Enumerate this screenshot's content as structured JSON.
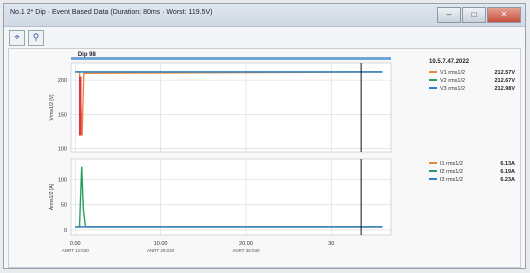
{
  "window": {
    "title": "No.1 2* Dip · Event Based Data (Duration: 80ms · Worst: 119.5V)",
    "minimize_icon": "minimize-icon",
    "maximize_icon": "maximize-icon",
    "close_icon": "close-icon"
  },
  "toolbar": {
    "icons": [
      "cursor-icon",
      "zoom-icon"
    ]
  },
  "marker_label": "Dip 98",
  "legend": {
    "timestamp": "10.5.7.47.2022",
    "voltage": [
      {
        "label": "V1 rms1/2",
        "value": "212.57V",
        "color": "#e8893a"
      },
      {
        "label": "V2 rms1/2",
        "value": "212.67V",
        "color": "#2a9e62"
      },
      {
        "label": "V3 rms1/2",
        "value": "212.98V",
        "color": "#2f7fd1"
      }
    ],
    "current": [
      {
        "label": "I1 rms1/2",
        "value": "6.13A",
        "color": "#e8893a"
      },
      {
        "label": "I2 rms1/2",
        "value": "6.19A",
        "color": "#2a9e62"
      },
      {
        "label": "I3 rms1/2",
        "value": "6.23A",
        "color": "#2f7fd1"
      }
    ]
  },
  "chart_data": [
    {
      "type": "line",
      "ylabel": "Vrms1/2 [V]",
      "yticks": [
        "200",
        "150",
        "100"
      ],
      "series": [
        {
          "name": "V1 rms1/2",
          "color": "#e8893a",
          "x": [
            0,
            0.5,
            0.8,
            1.0,
            36.0
          ],
          "y": [
            212,
            212,
            119,
            210,
            212
          ]
        },
        {
          "name": "V2 rms1/2",
          "color": "#2a9e62",
          "x": [
            0,
            36.0
          ],
          "y": [
            212,
            212
          ]
        },
        {
          "name": "V3 rms1/2",
          "color": "#2f7fd1",
          "x": [
            0,
            36.0
          ],
          "y": [
            212,
            212
          ]
        }
      ],
      "ylim": [
        95,
        225
      ]
    },
    {
      "type": "line",
      "ylabel": "Arms1/2 [A]",
      "yticks": [
        "100",
        "50",
        "0"
      ],
      "series": [
        {
          "name": "I1 rms1/2",
          "color": "#e8893a",
          "x": [
            0,
            0.6,
            1.0,
            36.0
          ],
          "y": [
            6,
            6,
            6,
            6
          ]
        },
        {
          "name": "I2 rms1/2",
          "color": "#2a9e62",
          "x": [
            0,
            0.5,
            0.75,
            0.95,
            1.2,
            36.0
          ],
          "y": [
            6,
            6,
            125,
            40,
            6,
            6
          ]
        },
        {
          "name": "I3 rms1/2",
          "color": "#2f7fd1",
          "x": [
            0,
            36.0
          ],
          "y": [
            6,
            6
          ]
        }
      ],
      "ylim": [
        -10,
        140
      ]
    }
  ],
  "x_axis": {
    "ticks": [
      {
        "main": "0.00",
        "sub": "ANRT 12:030"
      },
      {
        "main": "10.00",
        "sub": "ANRT 29:030"
      },
      {
        "main": "20.00",
        "sub": "ANRT 38:030"
      },
      {
        "main": "30",
        "sub": ""
      }
    ],
    "cursor_x": 33.5,
    "xlim": [
      -0.5,
      37.0
    ]
  }
}
